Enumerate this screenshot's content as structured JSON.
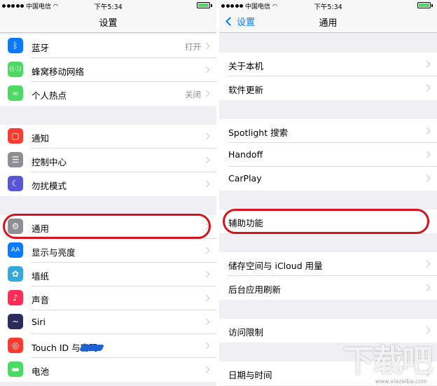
{
  "status": {
    "carrier": "中国电信",
    "time": "下午5:34"
  },
  "left": {
    "title": "设置",
    "groups": [
      [
        {
          "label": "蓝牙",
          "value": "打开",
          "icon": "bluetooth-icon",
          "color": "#0a7aff"
        },
        {
          "label": "蜂窝移动网络",
          "value": "",
          "icon": "cellular-icon",
          "color": "#4cd964"
        },
        {
          "label": "个人热点",
          "value": "关闭",
          "icon": "hotspot-icon",
          "color": "#4cd964"
        }
      ],
      [
        {
          "label": "通知",
          "value": "",
          "icon": "notifications-icon",
          "color": "#ff3b30"
        },
        {
          "label": "控制中心",
          "value": "",
          "icon": "control-center-icon",
          "color": "#8e8e93"
        },
        {
          "label": "勿扰模式",
          "value": "",
          "icon": "moon-icon",
          "color": "#5856d6"
        }
      ],
      [
        {
          "label": "通用",
          "value": "",
          "icon": "gear-icon",
          "color": "#8e8e93"
        },
        {
          "label": "显示与亮度",
          "value": "",
          "icon": "display-icon",
          "color": "#0a7aff"
        },
        {
          "label": "墙纸",
          "value": "",
          "icon": "wallpaper-icon",
          "color": "#34aadc"
        },
        {
          "label": "声音",
          "value": "",
          "icon": "sound-icon",
          "color": "#ff2d55"
        },
        {
          "label": "Siri",
          "value": "",
          "icon": "siri-icon",
          "color": "#2b2b5e"
        },
        {
          "label": "Touch ID 与密码",
          "value": "",
          "icon": "fingerprint-icon",
          "color": "#ff3b30"
        },
        {
          "label": "电池",
          "value": "",
          "icon": "battery-icon",
          "color": "#4cd964"
        }
      ]
    ]
  },
  "right": {
    "back": "设置",
    "title": "通用",
    "groups": [
      [
        "关于本机",
        "软件更新"
      ],
      [
        "Spotlight 搜索",
        "Handoff",
        "CarPlay"
      ],
      [
        "辅助功能"
      ],
      [
        "储存空间与 iCloud 用量",
        "后台应用刷新"
      ],
      [
        "访问限制"
      ],
      [
        "日期与时间"
      ]
    ]
  },
  "watermark": {
    "text": "下载吧",
    "sub": "www.xiazaiba.com"
  }
}
